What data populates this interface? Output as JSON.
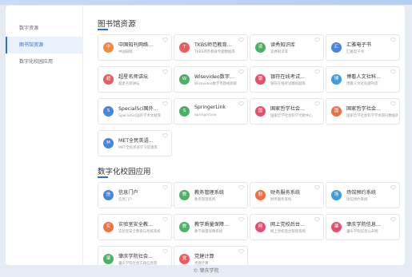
{
  "sidebar": {
    "items": [
      {
        "label": "数字资源",
        "active": false
      },
      {
        "label": "图书馆资源",
        "active": true
      },
      {
        "label": "数字化校园应用",
        "active": false
      }
    ]
  },
  "sections": [
    {
      "title": "图书馆资源",
      "cards": [
        {
          "title": "中国知刊网络...",
          "sub": "中国知网",
          "icon": "中",
          "color": "#f08a42"
        },
        {
          "title": "TKBS师范教育...",
          "sub": "TKBS师范教育专题数据库",
          "icon": "T",
          "color": "#ea5d5d"
        },
        {
          "title": "读秀知识库",
          "sub": "读秀知识库",
          "icon": "读",
          "color": "#4cb066"
        },
        {
          "title": "汇雅电子书",
          "sub": "汇雅电子书",
          "icon": "汇",
          "color": "#4a86d8"
        },
        {
          "title": "超星名师讲坛",
          "sub": "超星名师讲坛",
          "icon": "超",
          "color": "#ea5d5d"
        },
        {
          "title": "Wisevideo数字...",
          "sub": "Wisevideo数字专题视频库",
          "icon": "W",
          "color": "#4cb066"
        },
        {
          "title": "银符在线考试...",
          "sub": "银符在线考试模拟题库",
          "icon": "银",
          "color": "#e2506c"
        },
        {
          "title": "博看人文社科...",
          "sub": "博看人文社科期刊库",
          "icon": "博",
          "color": "#3d9de0"
        },
        {
          "title": "SpecialSci国外...",
          "sub": "SpecialSci国外学术文献库",
          "icon": "S",
          "color": "#4a86d8"
        },
        {
          "title": "SpringerLink",
          "sub": "SpringerLink",
          "icon": "S",
          "color": "#4cb066"
        },
        {
          "title": "国家哲学社会...",
          "sub": "国家哲学社会科学文献中心",
          "icon": "国",
          "color": "#e2506c"
        },
        {
          "title": "国家哲学社会...",
          "sub": "国家哲学社会科学学术期刊数据库",
          "icon": "国",
          "color": "#ef7043"
        },
        {
          "title": "MET全民英语...",
          "sub": "MET全民英语学习资源库",
          "icon": "M",
          "color": "#4a86d8"
        }
      ]
    },
    {
      "title": "数字化校园应用",
      "cards": [
        {
          "title": "信息门户",
          "sub": "信息门户",
          "icon": "信",
          "color": "#4a86d8"
        },
        {
          "title": "教务管理系统",
          "sub": "教务管理系统",
          "icon": "教",
          "color": "#4cb066"
        },
        {
          "title": "财务服务系统",
          "sub": "财务服务系统",
          "icon": "财",
          "color": "#ef7043"
        },
        {
          "title": "场馆预约系统",
          "sub": "场馆预约系统",
          "icon": "场",
          "color": "#3d9de0"
        },
        {
          "title": "实验室安全教...",
          "sub": "实验室安全教育与考核系统",
          "icon": "实",
          "color": "#ef7043"
        },
        {
          "title": "教学质量保障...",
          "sub": "教学质量保障系统",
          "icon": "教",
          "color": "#4cb066"
        },
        {
          "title": "网上党校后台...",
          "sub": "网上党校后台管理系统",
          "icon": "网",
          "color": "#e2506c"
        },
        {
          "title": "肇庆学院信息...",
          "sub": "肇庆学院信息公开网",
          "icon": "肇",
          "color": "#e2506c"
        },
        {
          "title": "肇庆学院社会...",
          "sub": "肇庆学院社会实践信息管",
          "icon": "肇",
          "color": "#4cb066"
        },
        {
          "title": "党建计算",
          "sub": "党建计算",
          "icon": "党",
          "color": "#ea5d5d"
        }
      ]
    }
  ],
  "footer": {
    "text": "© 肇庆学院"
  }
}
